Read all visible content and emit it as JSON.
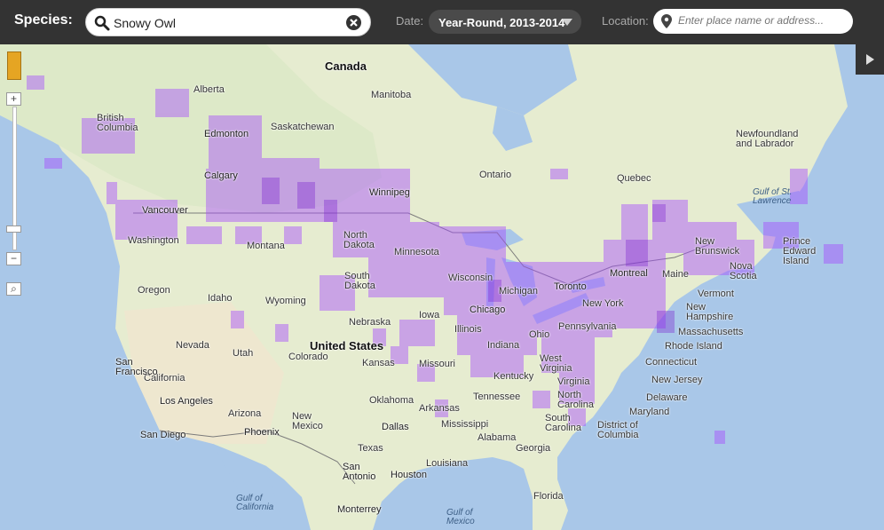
{
  "header": {
    "species_label": "Species:",
    "species_value": "Snowy Owl",
    "date_label": "Date:",
    "date_value": "Year-Round, 2013-2014",
    "location_label": "Location:",
    "location_placeholder": "Enter place name or address..."
  },
  "map": {
    "countries": [
      "Canada",
      "United States"
    ],
    "regions": [
      "Alberta",
      "British Columbia",
      "Saskatchewan",
      "Manitoba",
      "Ontario",
      "Quebec",
      "Newfoundland and Labrador",
      "Washington",
      "Oregon",
      "Idaho",
      "Montana",
      "Wyoming",
      "North Dakota",
      "South Dakota",
      "Minnesota",
      "Wisconsin",
      "Michigan",
      "Iowa",
      "Nebraska",
      "Illinois",
      "Indiana",
      "Ohio",
      "Pennsylvania",
      "New York",
      "Maine",
      "New Brunswick",
      "Nova Scotia",
      "Prince Edward Island",
      "Vermont",
      "New Hampshire",
      "Massachusetts",
      "Rhode Island",
      "Connecticut",
      "New Jersey",
      "Delaware",
      "Maryland",
      "District of Columbia",
      "Virginia",
      "West Virginia",
      "Kentucky",
      "Tennessee",
      "North Carolina",
      "South Carolina",
      "Georgia",
      "Alabama",
      "Mississippi",
      "Louisiana",
      "Arkansas",
      "Missouri",
      "Kansas",
      "Oklahoma",
      "Texas",
      "Colorado",
      "Utah",
      "Nevada",
      "California",
      "Arizona",
      "New Mexico",
      "Florida"
    ],
    "cities": [
      "Edmonton",
      "Calgary",
      "Vancouver",
      "Winnipeg",
      "Toronto",
      "Montreal",
      "Chicago",
      "San Francisco",
      "Los Angeles",
      "San Diego",
      "Phoenix",
      "Dallas",
      "San Antonio",
      "Houston",
      "Monterrey"
    ],
    "waters": [
      "Gulf of St. Lawrence",
      "Gulf of California",
      "Gulf of Mexico"
    ],
    "colors": {
      "land": "#e8efd2",
      "water": "#a9c7e8",
      "sighting": "#a64dff"
    }
  }
}
